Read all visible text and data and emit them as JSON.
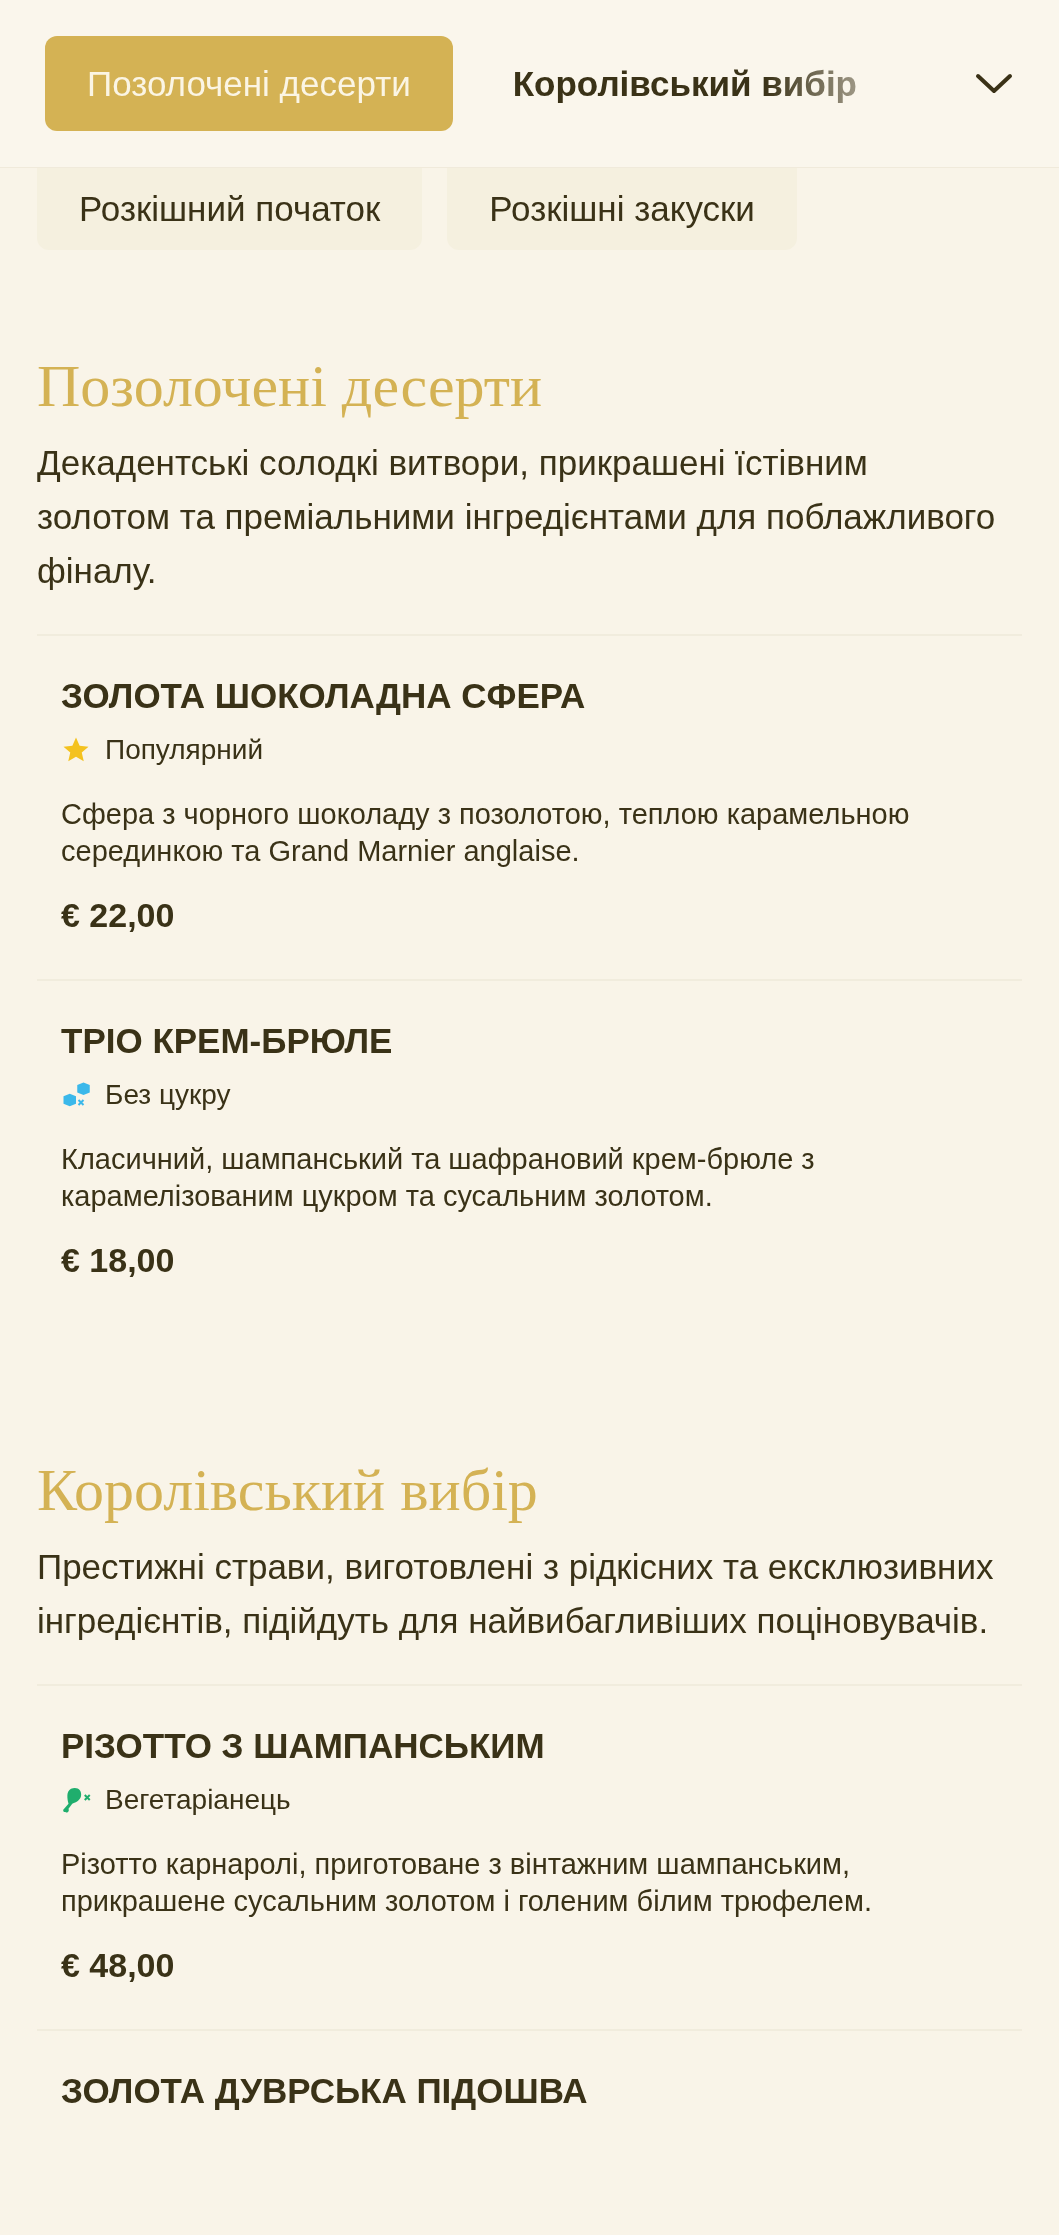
{
  "tabs": [
    {
      "label": "Позолочені десерти",
      "selected": true
    },
    {
      "label": "Королівський вибір",
      "selected": false
    }
  ],
  "more_tabs": [
    {
      "label": "Розкішний початок",
      "selected": false
    },
    {
      "label": "Розкішні закуски",
      "selected": false
    }
  ],
  "sections": [
    {
      "title": "Позолочені десерти",
      "description": "Декадентські солодкі витвори, прикрашені їстівним золотом та преміальними інгредієнтами для поблажливого фіналу.",
      "items": [
        {
          "name": "ЗОЛОТА ШОКОЛАДНА СФЕРА",
          "tag": {
            "kind": "popular",
            "label": "Популярний"
          },
          "description": "Сфера з чорного шоколаду з позолотою, теплою карамельною серединкою та Grand Marnier anglaise.",
          "price": "€ 22,00"
        },
        {
          "name": "ТРІО КРЕМ-БРЮЛЕ",
          "tag": {
            "kind": "sugar_free",
            "label": "Без цукру"
          },
          "description": "Класичний, шампанський та шафрановий крем-брюле з карамелізованим цукром та сусальним золотом.",
          "price": "€ 18,00"
        }
      ]
    },
    {
      "title": "Королівський вибір",
      "description": "Престижні страви, виготовлені з рідкісних та ексклюзивних інгредієнтів, підійдуть для найвибагливіших поціновувачів.",
      "items": [
        {
          "name": "РІЗОТТО З ШАМПАНСЬКИМ",
          "tag": {
            "kind": "vegetarian",
            "label": "Вегетаріанець"
          },
          "description": "Різотто карнаролі, приготоване з вінтажним шампанським, прикрашене сусальним золотом і голеним білим трюфелем.",
          "price": "€ 48,00"
        },
        {
          "name": "ЗОЛОТА ДУВРСЬКА ПІДОШВА"
        }
      ]
    }
  ]
}
